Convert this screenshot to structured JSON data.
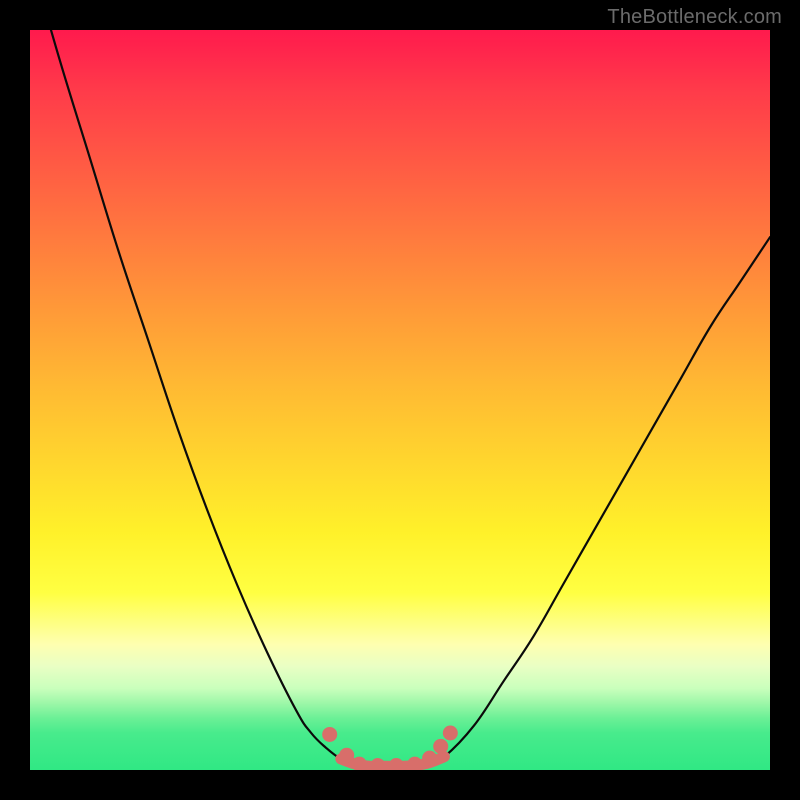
{
  "attribution": "TheBottleneck.com",
  "colors": {
    "page_bg": "#000000",
    "curve_stroke": "#0b0b0b",
    "marker_fill": "#d86e6a",
    "marker_stroke": "#d86e6a",
    "attribution_text": "#6b6b6b"
  },
  "chart_data": {
    "type": "line",
    "title": "",
    "xlabel": "",
    "ylabel": "",
    "xlim": [
      0,
      100
    ],
    "ylim": [
      0,
      100
    ],
    "grid": false,
    "legend": false,
    "series": [
      {
        "name": "left-arm",
        "x": [
          0,
          4,
          8,
          12,
          16,
          20,
          24,
          28,
          32,
          36,
          38,
          40,
          42
        ],
        "values": [
          110,
          96,
          83,
          70,
          58,
          46,
          35,
          25,
          16,
          8,
          5,
          3,
          1.5
        ]
      },
      {
        "name": "valley-floor",
        "x": [
          42,
          44,
          46,
          48,
          50,
          52,
          54,
          56
        ],
        "values": [
          1.5,
          0.8,
          0.5,
          0.5,
          0.5,
          0.6,
          1.0,
          1.8
        ]
      },
      {
        "name": "right-arm",
        "x": [
          56,
          60,
          64,
          68,
          72,
          76,
          80,
          84,
          88,
          92,
          96,
          100
        ],
        "values": [
          1.8,
          6,
          12,
          18,
          25,
          32,
          39,
          46,
          53,
          60,
          66,
          72
        ]
      }
    ],
    "markers": [
      {
        "name": "left-knee-upper",
        "x": 40.5,
        "y": 4.8
      },
      {
        "name": "left-knee-lower",
        "x": 42.8,
        "y": 2.0
      },
      {
        "name": "floor-a",
        "x": 44.5,
        "y": 0.8
      },
      {
        "name": "floor-b",
        "x": 47.0,
        "y": 0.6
      },
      {
        "name": "floor-c",
        "x": 49.5,
        "y": 0.6
      },
      {
        "name": "floor-d",
        "x": 52.0,
        "y": 0.8
      },
      {
        "name": "right-knee-a",
        "x": 54.0,
        "y": 1.6
      },
      {
        "name": "right-knee-b",
        "x": 55.5,
        "y": 3.2
      },
      {
        "name": "right-knee-c",
        "x": 56.8,
        "y": 5.0
      }
    ]
  }
}
